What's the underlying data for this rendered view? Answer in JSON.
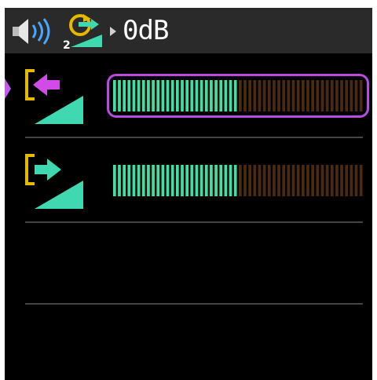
{
  "header": {
    "speaker_icon": "speaker-volume-icon",
    "mode_icon": "cycle-mode-icon",
    "mode_badge": "2",
    "value": "0dB"
  },
  "rows": [
    {
      "name": "input-level",
      "icon": "input-arrow-icon",
      "selected": true,
      "level_fraction": 0.5
    },
    {
      "name": "output-level",
      "icon": "output-arrow-icon",
      "selected": false,
      "level_fraction": 0.5
    },
    {
      "name": "empty-slot",
      "icon": "",
      "selected": false
    }
  ],
  "colors": {
    "accent": "#b94be0",
    "meter_active": "#3fe0a8",
    "meter_inactive": "#4a2a10",
    "bracket": "#e6b800",
    "arrow_in": "#d04be8",
    "arrow_out": "#3fd8b0"
  }
}
